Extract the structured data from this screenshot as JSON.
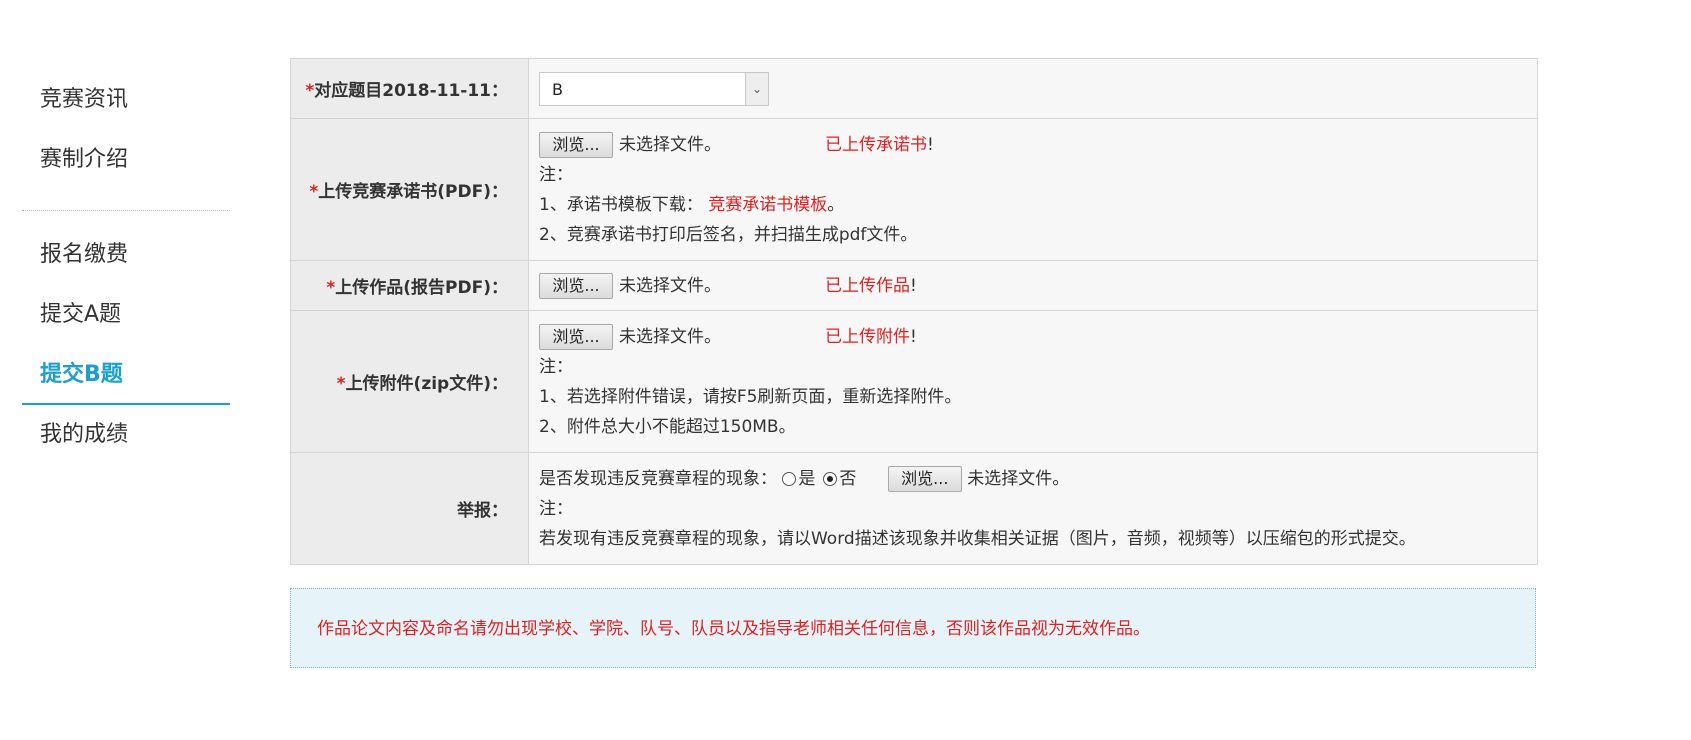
{
  "sidebar": {
    "items": [
      {
        "label": "竞赛资讯"
      },
      {
        "label": "赛制介绍"
      },
      {
        "label": "报名缴费"
      },
      {
        "label": "提交A题"
      },
      {
        "label": "提交B题"
      },
      {
        "label": "我的成绩"
      }
    ],
    "active_index": 4
  },
  "form": {
    "required_mark": "*",
    "topic": {
      "label": "对应题目2018-11-11：",
      "selected": "B"
    },
    "pledge": {
      "label": "上传竞赛承诺书(PDF)：",
      "browse": "浏览...",
      "no_file": "未选择文件。",
      "status": "已上传承诺书",
      "status_suffix": "!",
      "note_title": "注：",
      "note1_prefix": "1、承诺书模板下载：",
      "note1_link": "竞赛承诺书模板",
      "note1_suffix": "。",
      "note2": "2、竞赛承诺书打印后签名，并扫描生成pdf文件。"
    },
    "work": {
      "label": "上传作品(报告PDF)：",
      "browse": "浏览...",
      "no_file": "未选择文件。",
      "status": "已上传作品",
      "status_suffix": "!"
    },
    "attachment": {
      "label": "上传附件(zip文件)：",
      "browse": "浏览...",
      "no_file": "未选择文件。",
      "status": "已上传附件",
      "status_suffix": "!",
      "note_title": "注：",
      "note1": "1、若选择附件错误，请按F5刷新页面，重新选择附件。",
      "note2": "2、附件总大小不能超过150MB。"
    },
    "report": {
      "label": "举报：",
      "question": "是否发现违反竞赛章程的现象：",
      "yes": "是",
      "no": "否",
      "selected": "否",
      "browse": "浏览...",
      "no_file": "未选择文件。",
      "note_title": "注：",
      "note": "若发现有违反竞赛章程的现象，请以Word描述该现象并收集相关证据（图片，音频，视频等）以压缩包的形式提交。"
    }
  },
  "notice": "作品论文内容及命名请勿出现学校、学院、队号、队员以及指导老师相关任何信息，否则该作品视为无效作品。",
  "colors": {
    "accent": "#1a9fd1",
    "required": "#e02020",
    "notice_bg": "#e6f4fa"
  }
}
